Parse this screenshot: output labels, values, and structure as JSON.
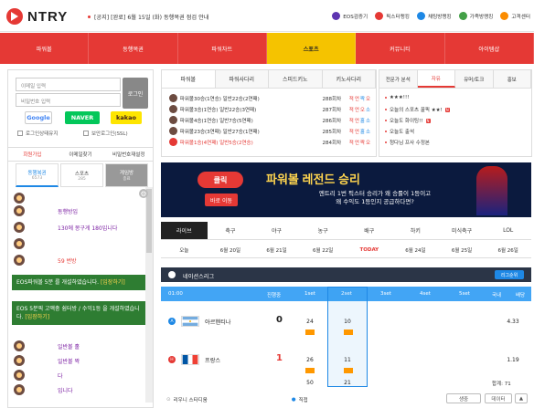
{
  "brand": {
    "name": "NTRY"
  },
  "notice": {
    "text": "[공지] [완료] 6월 15일 (화) 동행복권 점검 안내"
  },
  "toplinks": [
    {
      "label": "EOS검증기",
      "color": "#5e35b1"
    },
    {
      "label": "픽스터랭킹",
      "color": "#e53935"
    },
    {
      "label": "채팅방랭킹",
      "color": "#1e88e5"
    },
    {
      "label": "가족방랭킹",
      "color": "#43a047"
    },
    {
      "label": "고객센터",
      "color": "#fb8c00"
    }
  ],
  "mainnav": [
    "파워볼",
    "동행복권",
    "파워차트",
    "스포츠",
    "커뮤니티",
    "아이템샵"
  ],
  "login": {
    "id_placeholder": "이메일 입력",
    "pw_placeholder": "비밀번호 입력",
    "login_button": "로그인",
    "google": "Google",
    "naver": "NAVER",
    "kakao": "kakao",
    "keep_login": "로그인상태유지",
    "secure_login": "보안로그인(SSL)"
  },
  "lefttabs": [
    "회원가입",
    "이메일찾기",
    "비밀번호재설정"
  ],
  "chattabs": [
    {
      "label": "동행복권",
      "sub": "6573"
    },
    {
      "label": "스포츠",
      "sub": "285"
    },
    {
      "label": "게임방",
      "sub": "종료"
    }
  ],
  "chat": {
    "msg1": "동행방입",
    "msg2": "130에 몽구게 180입니다",
    "msg3": "59 번방",
    "green1_a": "EOS파워볼 5분 ",
    "green1_b": "를 개설하였습니다. ",
    "green1_link": "[입장하기]",
    "green2_a": "EOS 5분픽 ",
    "green2_b": "고액충 쉼터방 / 수익1등 ",
    "green2_c": "을 개설하였습니다. ",
    "green2_link": "[입장하기]",
    "msg4": "일반볼 홀",
    "msg5": "일반볼 짝",
    "msg6": "다",
    "msg7": "다",
    "msg8": "입니다"
  },
  "powertabs": [
    "파워볼",
    "파워사다리",
    "스피드키노",
    "키노사다리"
  ],
  "powerrows": [
    {
      "text": "파워볼30승(1연승) 일반22승(2연패)",
      "round": "288회차",
      "pick": [
        "적",
        "언",
        "짝",
        "오"
      ]
    },
    {
      "text": "파워볼3승(1연승) 일반22승(3연패)",
      "round": "287회차",
      "pick": [
        "적",
        "언",
        "오",
        "소"
      ]
    },
    {
      "text": "파워볼4승(1연승) 일반7승(5연패)",
      "round": "286회차",
      "pick": [
        "적",
        "언",
        "홀",
        "소"
      ]
    },
    {
      "text": "파워볼23승(3연패) 일반27승(1연패)",
      "round": "285회차",
      "pick": [
        "적",
        "언",
        "홀",
        "소"
      ]
    },
    {
      "text": "파워볼1승(4연패) 일반5승(2연승)",
      "round": "284회차",
      "pick": [
        "적",
        "언",
        "짝",
        "오"
      ]
    }
  ],
  "boardtabs": [
    "전문가 분석",
    "자유",
    "유머/토크",
    "홍보"
  ],
  "boardrows": [
    {
      "text": "★★★!!!",
      "badge": ""
    },
    {
      "text": "오늘의 스포츠 꿀픽 ★★!",
      "badge": "N"
    },
    {
      "text": "오늘도 화이팅!!",
      "badge": "N"
    },
    {
      "text": "오늘도 출석",
      "badge": ""
    },
    {
      "text": "청다님 프사 수정본",
      "badge": ""
    }
  ],
  "banner": {
    "logo": "클릭",
    "button": "바로 이동",
    "title": "파워볼 레전드 승리",
    "sub1": "엔트리 1번 픽스터 승리가 왜 승률이 1등이고",
    "sub2": "왜 수익도 1등인지 공급하다면?"
  },
  "sportstabs": [
    "라이브",
    "축구",
    "야구",
    "농구",
    "배구",
    "하키",
    "미식축구",
    "LOL"
  ],
  "dates": [
    "오늘",
    "6월 20일",
    "6월 21일",
    "6월 22일",
    "TODAY",
    "6월 24일",
    "6월 25일",
    "6월 26일"
  ],
  "league": {
    "name": "네이션스리그",
    "button": "리그순위"
  },
  "scoreheader": {
    "time": "01:00",
    "progress": "진행중",
    "set1": "1set",
    "set2": "2set",
    "set3": "3set",
    "set4": "4set",
    "set5": "5set",
    "extra": "국내",
    "rate": "배당"
  },
  "match": {
    "home": {
      "name": "아르헨티나",
      "score": "0",
      "s1": "24",
      "s2": "10",
      "rate": "4.33",
      "badge": "A"
    },
    "away": {
      "name": "프랑스",
      "score": "1",
      "s1": "26",
      "s2": "11",
      "rate": "1.19",
      "badge": "H"
    },
    "set1_total": "50",
    "set2_total": "21",
    "total_label": "합계: 71"
  },
  "footer": {
    "venue": "리우니 스타디움",
    "live_label": "직접",
    "btn1": "생중",
    "btn2": "데이터"
  }
}
